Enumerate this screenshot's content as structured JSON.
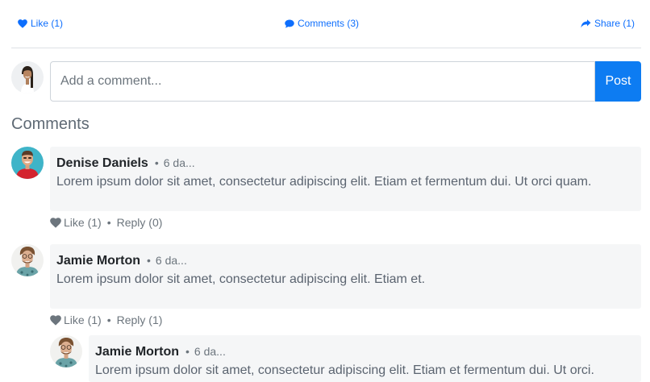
{
  "actions": {
    "like": "Like (1)",
    "comments": "Comments (3)",
    "share": "Share (1)"
  },
  "composer": {
    "placeholder": "Add a comment...",
    "post_label": "Post"
  },
  "comments_title": "Comments",
  "comments": [
    {
      "author": "Denise Daniels",
      "time": "6 da...",
      "text": "Lorem ipsum dolor sit amet, consectetur adipiscing elit. Etiam et fermentum dui. Ut orci quam.",
      "like": "Like (1)",
      "reply": "Reply (0)"
    },
    {
      "author": "Jamie Morton",
      "time": "6 da...",
      "text": "Lorem ipsum dolor sit amet, consectetur adipiscing elit. Etiam et.",
      "like": "Like (1)",
      "reply": "Reply (1)"
    },
    {
      "author": "Jamie Morton",
      "time": "6 da...",
      "text": "Lorem ipsum dolor sit amet, consectetur adipiscing elit. Etiam et fermentum dui. Ut orci."
    }
  ],
  "colors": {
    "accent": "#0d7cf2",
    "bubble": "#f5f6f7",
    "muted": "#6c757d"
  },
  "icons": {
    "like": "heart-icon",
    "comments": "comment-icon",
    "share": "share-icon"
  }
}
